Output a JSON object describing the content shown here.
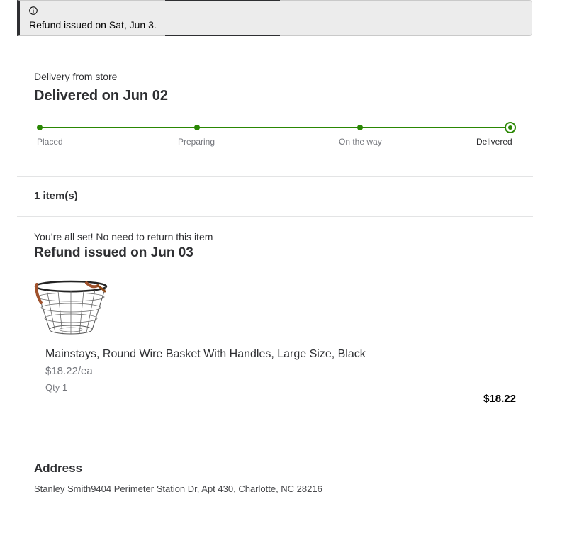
{
  "alert": {
    "icon": "info-icon",
    "message": "Refund issued on Sat, Jun 3."
  },
  "delivery": {
    "subtitle": "Delivery from store",
    "title": "Delivered on Jun 02",
    "accent_color": "#2a8703",
    "steps": [
      {
        "label": "Placed",
        "state": "complete"
      },
      {
        "label": "Preparing",
        "state": "complete"
      },
      {
        "label": "On the way",
        "state": "complete"
      },
      {
        "label": "Delivered",
        "state": "current"
      }
    ]
  },
  "items": {
    "count_label": "1 item(s)"
  },
  "refund": {
    "note": "You’re all set! No need to return this item",
    "title": "Refund issued on Jun 03"
  },
  "product": {
    "image_icon": "wire-basket-image",
    "name": "Mainstays, Round Wire Basket With Handles, Large Size, Black",
    "unit_price": "$18.22/ea",
    "quantity": "Qty 1",
    "total": "$18.22"
  },
  "address": {
    "heading": "Address",
    "text": "Stanley Smith9404 Perimeter Station Dr, Apt 430, Charlotte, NC 28216"
  }
}
